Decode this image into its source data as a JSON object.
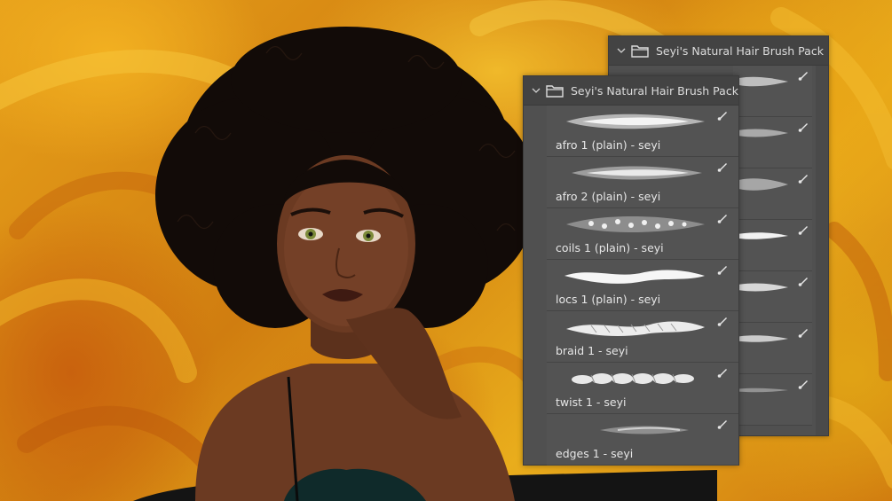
{
  "back_panel": {
    "title": "Seyi's Natural Hair Brush Pack",
    "icons": {
      "collapse": "chevron-down-icon",
      "folder": "folder-icon",
      "brush": "brush-icon"
    }
  },
  "front_panel": {
    "title": "Seyi's Natural Hair Brush Pack",
    "brushes": [
      {
        "label": "afro 1 (plain) - seyi",
        "stroke_style": "soft-wispy"
      },
      {
        "label": "afro 2 (plain) - seyi",
        "stroke_style": "soft-wispy"
      },
      {
        "label": "coils 1 (plain) - seyi",
        "stroke_style": "speckled"
      },
      {
        "label": "locs 1 (plain) - seyi",
        "stroke_style": "solid"
      },
      {
        "label": "braid 1 - seyi",
        "stroke_style": "braid"
      },
      {
        "label": "twist 1 - seyi",
        "stroke_style": "twist"
      },
      {
        "label": "edges 1 - seyi",
        "stroke_style": "faint"
      }
    ]
  },
  "colors": {
    "panel_bg": "#505050",
    "panel_header": "#434343",
    "text": "#e6e6e6",
    "background_orange": "#d98a12",
    "skin": "#6b3a22",
    "hair": "#120b08"
  }
}
